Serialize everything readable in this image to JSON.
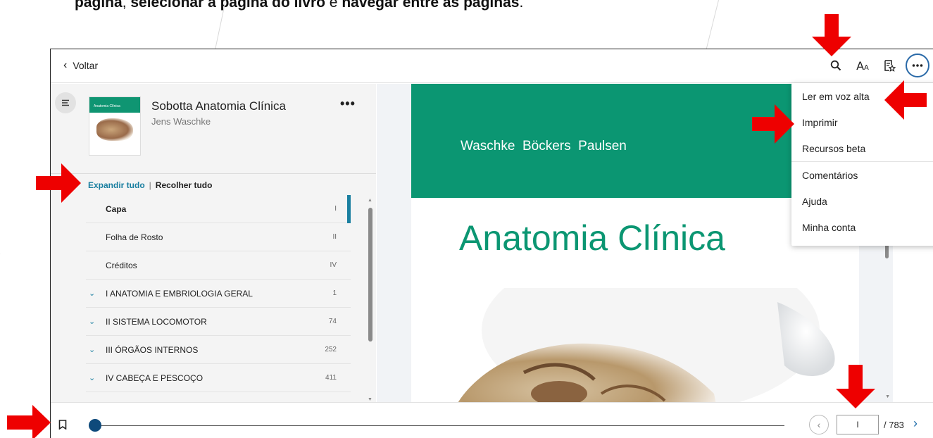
{
  "caption": {
    "bold_start": "página",
    "normal_1": ", ",
    "bold_mid": "selecionar a página do livro",
    "normal_2": " e ",
    "bold_end": "navegar entre as páginas",
    "normal_3": "."
  },
  "topbar": {
    "back_label": "Voltar",
    "icons": [
      "search-icon",
      "text-size-icon",
      "bookmark-list-icon",
      "more-options-icon"
    ]
  },
  "sidebar": {
    "book_title": "Sobotta Anatomia Clínica",
    "book_author": "Jens Waschke",
    "cover_title": "Anatomia Clínica",
    "more_label": "•••",
    "expand_all": "Expandir tudo",
    "separator": "|",
    "collapse_all": "Recolher tudo",
    "toc": [
      {
        "label": "Capa",
        "page": "I",
        "active": true,
        "expandable": false
      },
      {
        "label": "Folha de Rosto",
        "page": "II",
        "active": false,
        "expandable": false
      },
      {
        "label": "Créditos",
        "page": "IV",
        "active": false,
        "expandable": false
      },
      {
        "label": "I ANATOMIA E EMBRIOLOGIA GERAL",
        "page": "1",
        "active": false,
        "expandable": true
      },
      {
        "label": "II SISTEMA LOCOMOTOR",
        "page": "74",
        "active": false,
        "expandable": true
      },
      {
        "label": "III ÓRGÃOS INTERNOS",
        "page": "252",
        "active": false,
        "expandable": true
      },
      {
        "label": "IV CABEÇA E PESCOÇO",
        "page": "411",
        "active": false,
        "expandable": true
      }
    ]
  },
  "viewer": {
    "authors": "Waschke  Böckers  Paulsen",
    "title": "Anatomia Clínica"
  },
  "menu": {
    "items": [
      "Ler em voz alta",
      "Imprimir",
      "Recursos beta",
      "Comentários",
      "Ajuda",
      "Minha conta"
    ]
  },
  "bottombar": {
    "page_value": "I",
    "page_total": "/ 783",
    "progress": 0.0
  },
  "colors": {
    "accent": "#1a7fa0",
    "book_green": "#0b9672",
    "arrow_red": "#ee0000",
    "knob": "#0e4a7b"
  }
}
